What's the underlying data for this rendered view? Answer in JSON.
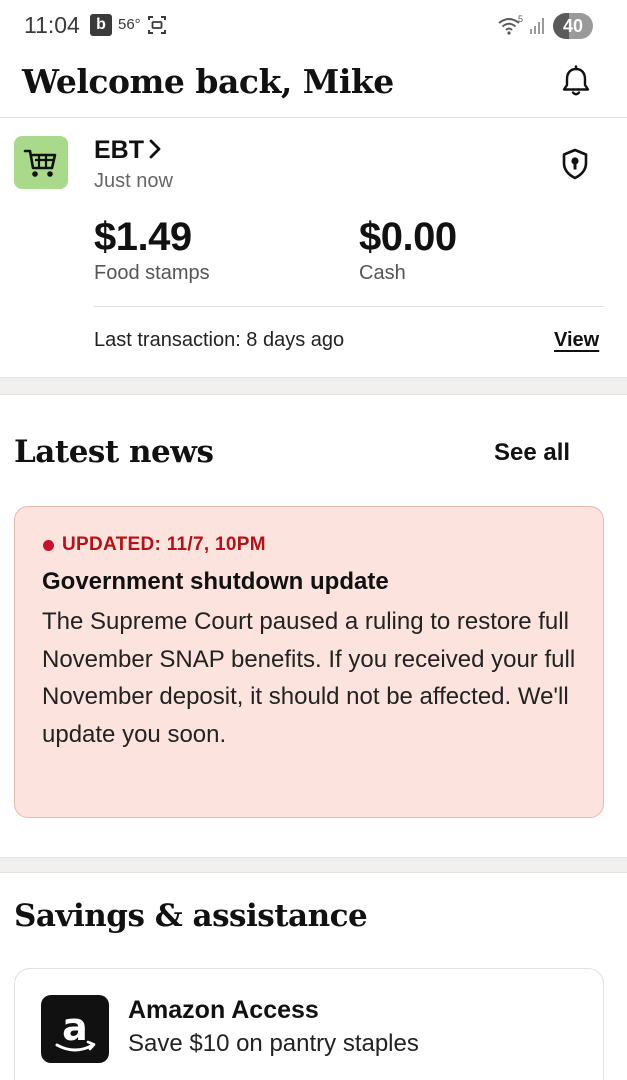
{
  "status_bar": {
    "time": "11:04",
    "app_badge": "b",
    "temperature": "56°",
    "wifi_label": "5",
    "battery": "40",
    "battery_level": 0.4
  },
  "header": {
    "title": "Welcome back, Mike",
    "bell_icon": "bell-icon"
  },
  "ebt": {
    "title": "EBT",
    "subtitle": "Just now",
    "icon": "shopping-cart-icon",
    "shield_icon": "shield-lock-icon",
    "food_stamps_amount": "$1.49",
    "food_stamps_label": "Food stamps",
    "cash_amount": "$0.00",
    "cash_label": "Cash",
    "last_transaction": "Last transaction: 8 days ago",
    "view_label": "View"
  },
  "news": {
    "section_title": "Latest news",
    "see_all_label": "See all",
    "tag": "UPDATED: 11/7, 10PM",
    "headline": "Government shutdown update",
    "body": "The Supreme Court paused a ruling to restore full November SNAP benefits. If you received your full November deposit, it should not be affected. We'll update you soon.",
    "accent_color": "#c8102e",
    "card_color": "#fde3dd"
  },
  "savings": {
    "section_title": "Savings & assistance",
    "offers": [
      {
        "title": "Amazon Access",
        "subtitle": "Save $10 on pantry staples",
        "icon": "amazon-logo-icon"
      }
    ]
  },
  "colors": {
    "ebt_icon_bg": "#a9d98b",
    "section_band": "#f2f0ee"
  }
}
